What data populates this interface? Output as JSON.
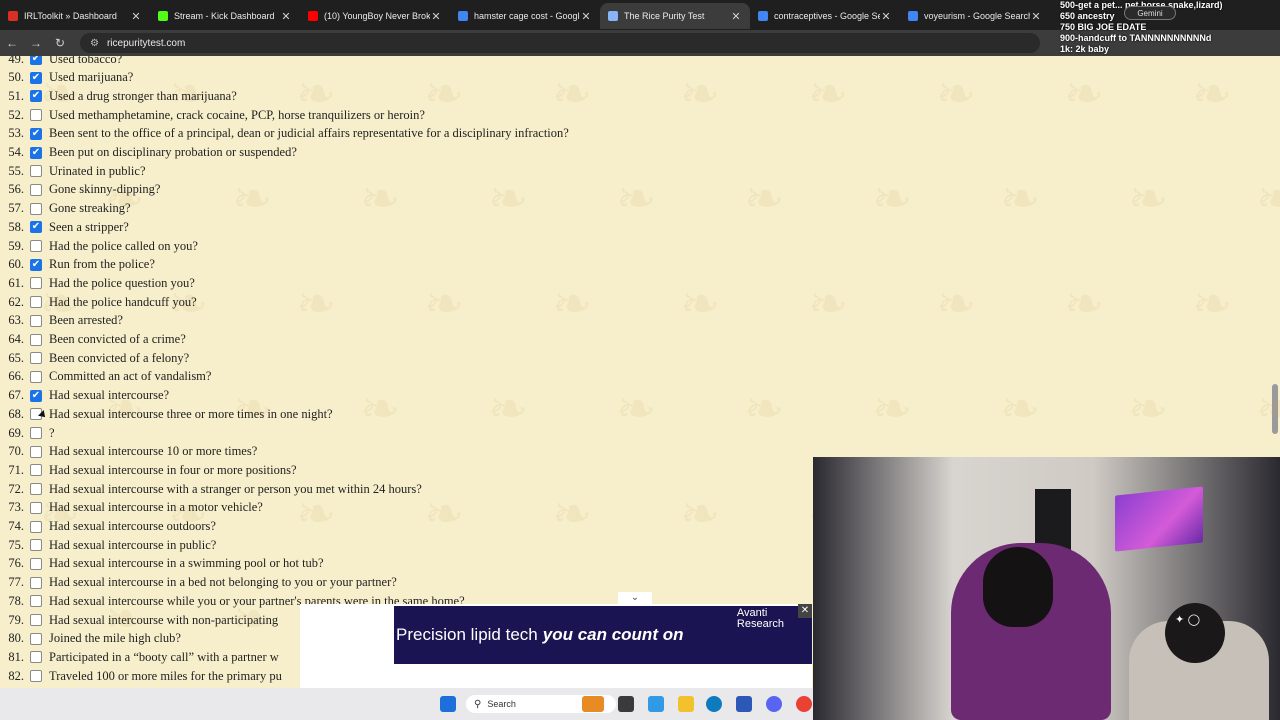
{
  "browser": {
    "tabs": [
      {
        "title": "IRLToolkit » Dashboard",
        "color": "#d93025"
      },
      {
        "title": "Stream - Kick Dashboard",
        "color": "#53fc18"
      },
      {
        "title": "(10) YoungBoy Never Broke A",
        "color": "#ff0000"
      },
      {
        "title": "hamster cage cost - Google S",
        "color": "#4285f4"
      },
      {
        "title": "The Rice Purity Test",
        "color": "#8ab4f8",
        "active": true
      },
      {
        "title": "contraceptives - Google Sea",
        "color": "#4285f4"
      },
      {
        "title": "voyeurism - Google Search",
        "color": "#4285f4"
      }
    ],
    "url": "ricepuritytest.com"
  },
  "overlay": {
    "line1": "500-get a pet... pet horse,snake,lizard)",
    "line2": "650 ancestry",
    "line3": "750 BIG JOE EDATE",
    "line4": "900-handcuff to TANNNNNNNNNNd",
    "line5": "1k: 2k baby",
    "gemini": "Gemini"
  },
  "questions": [
    {
      "n": "49.",
      "text": "Used tobacco?",
      "checked": true
    },
    {
      "n": "50.",
      "text": "Used marijuana?",
      "checked": true
    },
    {
      "n": "51.",
      "text": "Used a drug stronger than marijuana?",
      "checked": true
    },
    {
      "n": "52.",
      "text": "Used methamphetamine, crack cocaine, PCP, horse tranquilizers or heroin?",
      "checked": false
    },
    {
      "n": "53.",
      "text": "Been sent to the office of a principal, dean or judicial affairs representative for a disciplinary infraction?",
      "checked": true
    },
    {
      "n": "54.",
      "text": "Been put on disciplinary probation or suspended?",
      "checked": true
    },
    {
      "n": "55.",
      "text": "Urinated in public?",
      "checked": false
    },
    {
      "n": "56.",
      "text": "Gone skinny-dipping?",
      "checked": false
    },
    {
      "n": "57.",
      "text": "Gone streaking?",
      "checked": false
    },
    {
      "n": "58.",
      "text": "Seen a stripper?",
      "checked": true
    },
    {
      "n": "59.",
      "text": "Had the police called on you?",
      "checked": false
    },
    {
      "n": "60.",
      "text": "Run from the police?",
      "checked": true
    },
    {
      "n": "61.",
      "text": "Had the police question you?",
      "checked": false
    },
    {
      "n": "62.",
      "text": "Had the police handcuff you?",
      "checked": false
    },
    {
      "n": "63.",
      "text": "Been arrested?",
      "checked": false
    },
    {
      "n": "64.",
      "text": "Been convicted of a crime?",
      "checked": false
    },
    {
      "n": "65.",
      "text": "Been convicted of a felony?",
      "checked": false
    },
    {
      "n": "66.",
      "text": "Committed an act of vandalism?",
      "checked": false
    },
    {
      "n": "67.",
      "text": "Had sexual intercourse?",
      "checked": true
    },
    {
      "n": "68.",
      "text": "Had sexual intercourse three or more times in one night?",
      "checked": false
    },
    {
      "n": "69.",
      "text": "?",
      "checked": false
    },
    {
      "n": "70.",
      "text": "Had sexual intercourse 10 or more times?",
      "checked": false
    },
    {
      "n": "71.",
      "text": "Had sexual intercourse in four or more positions?",
      "checked": false
    },
    {
      "n": "72.",
      "text": "Had sexual intercourse with a stranger or person you met within 24 hours?",
      "checked": false
    },
    {
      "n": "73.",
      "text": "Had sexual intercourse in a motor vehicle?",
      "checked": false
    },
    {
      "n": "74.",
      "text": "Had sexual intercourse outdoors?",
      "checked": false
    },
    {
      "n": "75.",
      "text": "Had sexual intercourse in public?",
      "checked": false
    },
    {
      "n": "76.",
      "text": "Had sexual intercourse in a swimming pool or hot tub?",
      "checked": false
    },
    {
      "n": "77.",
      "text": "Had sexual intercourse in a bed not belonging to you or your partner?",
      "checked": false
    },
    {
      "n": "78.",
      "text": "Had sexual intercourse while you or your partner's parents were in the same home?",
      "checked": false
    },
    {
      "n": "79.",
      "text": "Had sexual intercourse with non-participating",
      "checked": false
    },
    {
      "n": "80.",
      "text": "Joined the mile high club?",
      "checked": false
    },
    {
      "n": "81.",
      "text": "Participated in a “booty call” with a partner w",
      "checked": false
    },
    {
      "n": "82.",
      "text": "Traveled 100 or more miles for the primary pu",
      "checked": false
    }
  ],
  "ad": {
    "text1": "Precision lipid tech",
    "text2": "you can count on",
    "brand1": "Avanti",
    "brand2": "Research"
  },
  "taskbar": {
    "search_placeholder": "Search"
  }
}
